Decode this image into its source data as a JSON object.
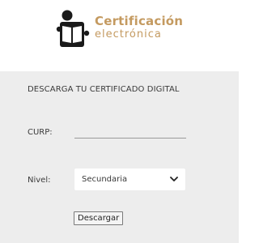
{
  "logo": {
    "line1": "Certificación",
    "line2": "electrónica",
    "icon": "reader-with-book-icon",
    "brand_color": "#c49a60",
    "icon_color": "#1a1a1a"
  },
  "form": {
    "heading": "DESCARGA TU CERTIFICADO DIGITAL",
    "curp_label": "CURP:",
    "curp_value": "",
    "nivel_label": "Nivel:",
    "nivel_selected": "Secundaria",
    "download_label": "Descargar",
    "panel_color": "#ededed"
  }
}
